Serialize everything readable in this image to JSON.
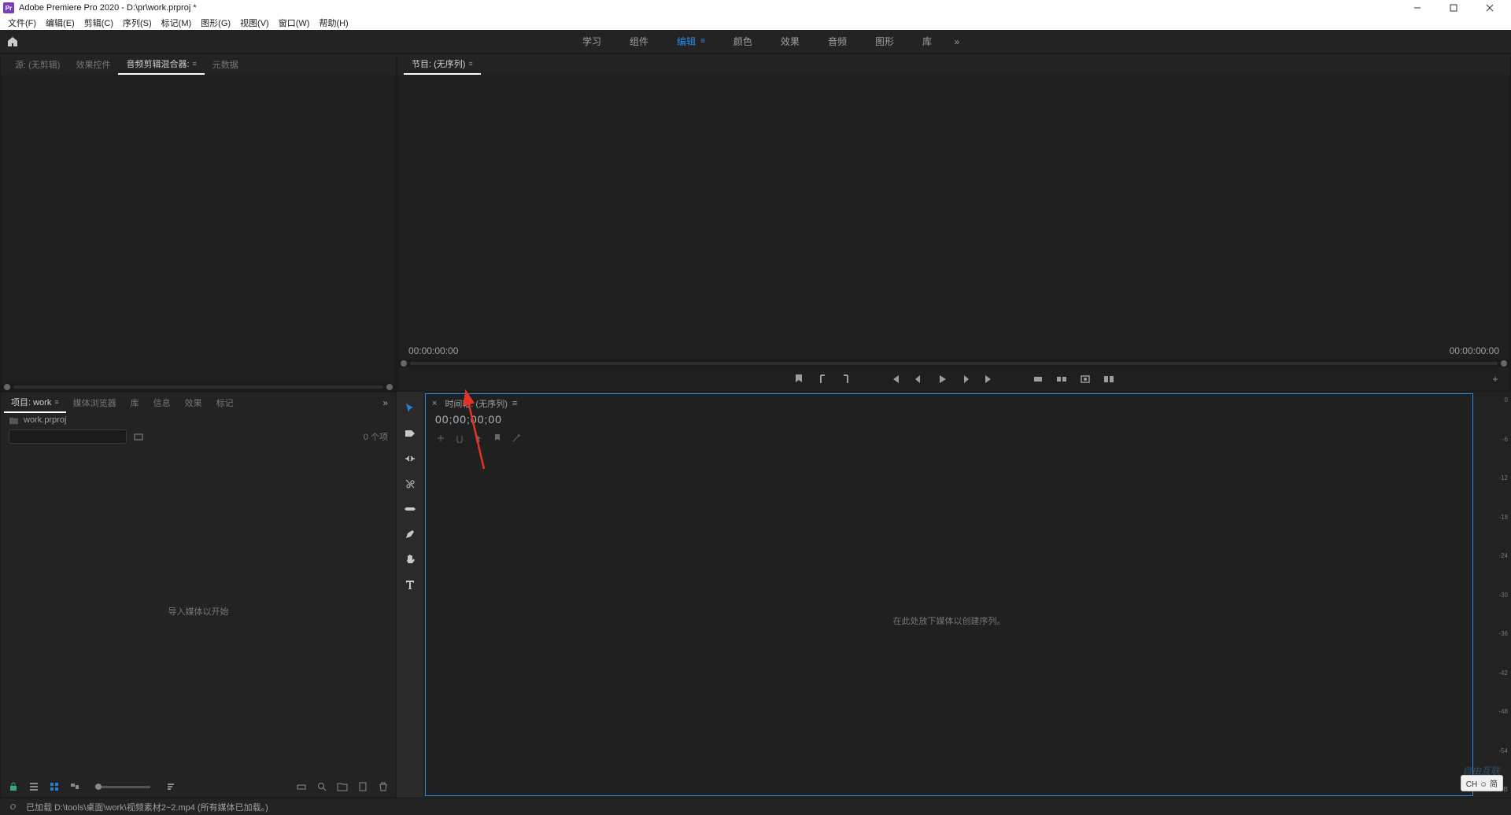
{
  "app": {
    "icon_text": "Pr",
    "title": "Adobe Premiere Pro 2020 - D:\\pr\\work.prproj *"
  },
  "menu": [
    "文件(F)",
    "编辑(E)",
    "剪辑(C)",
    "序列(S)",
    "标记(M)",
    "图形(G)",
    "视图(V)",
    "窗口(W)",
    "帮助(H)"
  ],
  "workspaces": {
    "items": [
      "学习",
      "组件",
      "编辑",
      "颜色",
      "效果",
      "音频",
      "图形",
      "库"
    ],
    "active_index": 2,
    "overflow_glyph": "»"
  },
  "source_panel": {
    "tabs": [
      "源: (无剪辑)",
      "效果控件",
      "音频剪辑混合器:",
      "元数据"
    ],
    "active_index": 2
  },
  "program_panel": {
    "tab": "节目: (无序列)",
    "tc_left": "00:00:00:00",
    "tc_right": "00:00:00:00",
    "plus_glyph": "+"
  },
  "project_panel": {
    "tabs": [
      "项目: work",
      "媒体浏览器",
      "库",
      "信息",
      "效果",
      "标记"
    ],
    "active_index": 0,
    "overflow": "»",
    "bin_name": "work.prproj",
    "item_count": "0 个项",
    "drop_text": "导入媒体以开始"
  },
  "tools": [
    "selection",
    "track-select",
    "ripple",
    "razor",
    "slip",
    "pen",
    "hand",
    "type"
  ],
  "timeline": {
    "label": "时间轴: (无序列)",
    "timecode": "00;00;00;00",
    "drop_text": "在此处放下媒体以创建序列。",
    "menu_glyph": "≡"
  },
  "meters": {
    "scale": [
      "0",
      "-6",
      "-12",
      "-18",
      "-24",
      "-30",
      "-36",
      "-42",
      "-48",
      "-54",
      "dB"
    ]
  },
  "status": {
    "text": "已加载 D:\\tools\\桌面\\work\\视频素材2~2.mp4 (所有媒体已加载。)"
  },
  "ime": {
    "text": "CH ☺ 简"
  },
  "watermark": {
    "text": "自由互联"
  }
}
